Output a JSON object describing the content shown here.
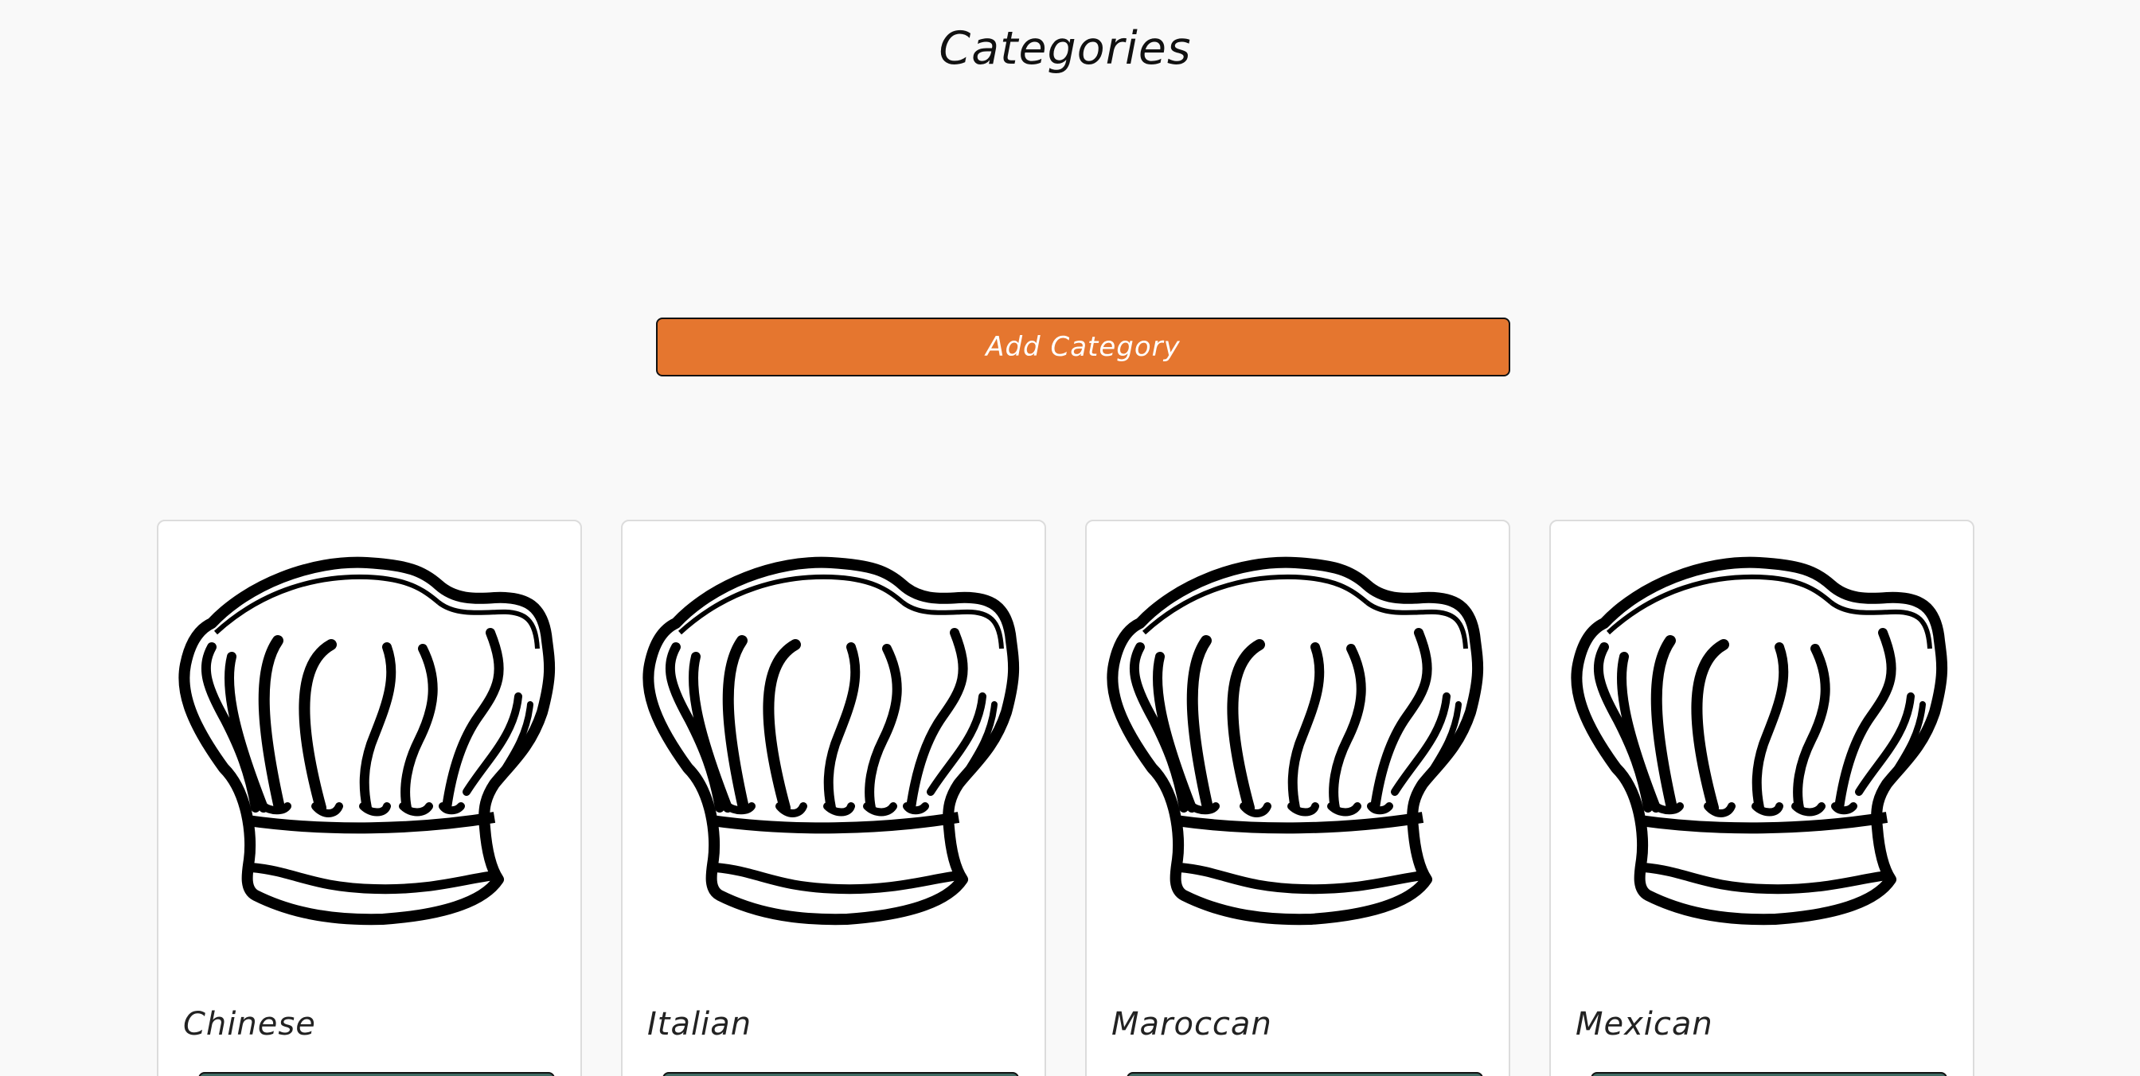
{
  "page": {
    "title": "Categories"
  },
  "actions": {
    "add_category_label": "Add Category"
  },
  "categories": [
    {
      "name": "Chinese",
      "image_icon": "chef-hat-icon"
    },
    {
      "name": "Italian",
      "image_icon": "chef-hat-icon"
    },
    {
      "name": "Maroccan",
      "image_icon": "chef-hat-icon"
    },
    {
      "name": "Mexican",
      "image_icon": "chef-hat-icon"
    }
  ],
  "colors": {
    "background": "#f9f9f9",
    "accent_orange": "#e5762f",
    "card_button": "#3f6b63",
    "card_border": "#dcdcdc"
  }
}
